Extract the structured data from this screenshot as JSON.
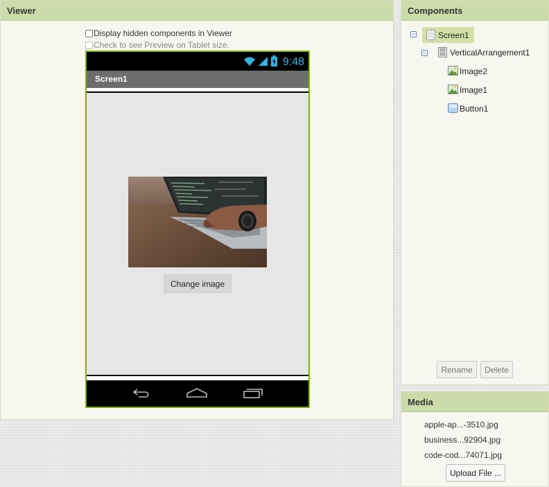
{
  "viewer": {
    "header": "Viewer",
    "checkbox_hidden_label": "Display hidden components in Viewer",
    "checkbox_tablet_label": "Check to see Preview on Tablet size.",
    "phone": {
      "time": "9:48",
      "title": "Screen1",
      "change_button_label": "Change image"
    }
  },
  "components": {
    "header": "Components",
    "tree": {
      "screen": "Screen1",
      "arrangement": "VerticalArrangement1",
      "children": [
        "Image2",
        "Image1",
        "Button1"
      ]
    },
    "rename_label": "Rename",
    "delete_label": "Delete"
  },
  "media": {
    "header": "Media",
    "files": [
      "apple-ap...-3510.jpg",
      "business...92904.jpg",
      "code-cod...74071.jpg"
    ],
    "upload_label": "Upload File ..."
  },
  "colors": {
    "header_bg": "#ccdbaa",
    "phone_border": "#7bb300",
    "status_accent": "#33b5e5"
  }
}
